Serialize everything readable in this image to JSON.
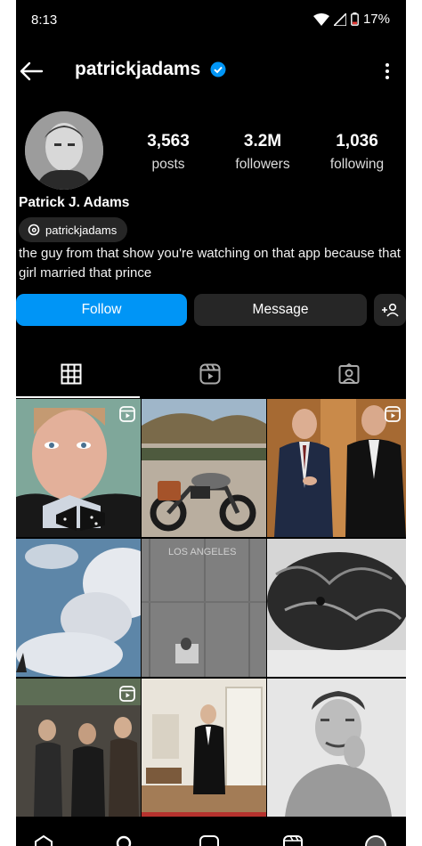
{
  "status": {
    "time": "8:13",
    "battery": "17%"
  },
  "header": {
    "username": "patrickjadams"
  },
  "stats": [
    {
      "value": "3,563",
      "label": "posts"
    },
    {
      "value": "3.2M",
      "label": "followers"
    },
    {
      "value": "1,036",
      "label": "following"
    }
  ],
  "profile": {
    "full_name": "Patrick J. Adams",
    "threads_handle": "patrickjadams",
    "bio": "the guy from that show you're watching on that app because that girl married that prince"
  },
  "actions": {
    "follow": "Follow",
    "message": "Message"
  },
  "tabs": [
    "posts-grid",
    "reels",
    "tagged"
  ],
  "grid": {
    "tiles": [
      {
        "name": "bowtie-portrait",
        "reel": true
      },
      {
        "name": "motorcycle-photo",
        "reel": false
      },
      {
        "name": "suits-photo",
        "reel": true
      },
      {
        "name": "clouds-photo",
        "reel": false
      },
      {
        "name": "los-angeles-wall-photo",
        "reel": false
      },
      {
        "name": "dog-photo",
        "reel": false
      },
      {
        "name": "crowd-photo",
        "reel": true
      },
      {
        "name": "tuxedo-room-photo",
        "reel": false
      },
      {
        "name": "bw-portrait-photo",
        "reel": false
      }
    ],
    "wall_text": "LOS ANGELES"
  },
  "colors": {
    "accent": "#0095f6",
    "verified": "#0095f6",
    "surface": "#262626"
  }
}
